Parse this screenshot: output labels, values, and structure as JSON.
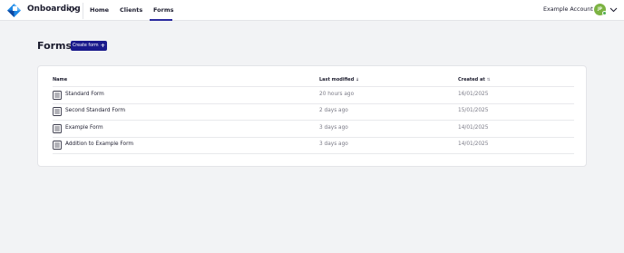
{
  "app": {
    "name": "Onboarding"
  },
  "nav": {
    "home": "Home",
    "clients": "Clients",
    "forms": "Forms"
  },
  "account": {
    "name": "Example Account",
    "initials": "JP"
  },
  "page": {
    "title": "Forms",
    "create_label": "Create form"
  },
  "table": {
    "headers": {
      "name": "Name",
      "modified": "Last modified",
      "created": "Created at"
    },
    "rows": [
      {
        "name": "Standard Form",
        "modified": "20 hours ago",
        "created": "16/01/2025"
      },
      {
        "name": "Second Standard Form",
        "modified": "2 days ago",
        "created": "15/01/2025"
      },
      {
        "name": "Example Form",
        "modified": "3 days ago",
        "created": "14/01/2025"
      },
      {
        "name": "Addition to Example Form",
        "modified": "3 days ago",
        "created": "14/01/2025"
      }
    ]
  },
  "colors": {
    "accent": "#1a1a8c",
    "brand_blue": "#1e88e5",
    "avatar": "#7cb342",
    "background": "#f2f3f5"
  },
  "icons": {
    "logo": "diamond-logo-icon",
    "chevron": "chevron-down-icon",
    "form": "form-document-icon"
  }
}
